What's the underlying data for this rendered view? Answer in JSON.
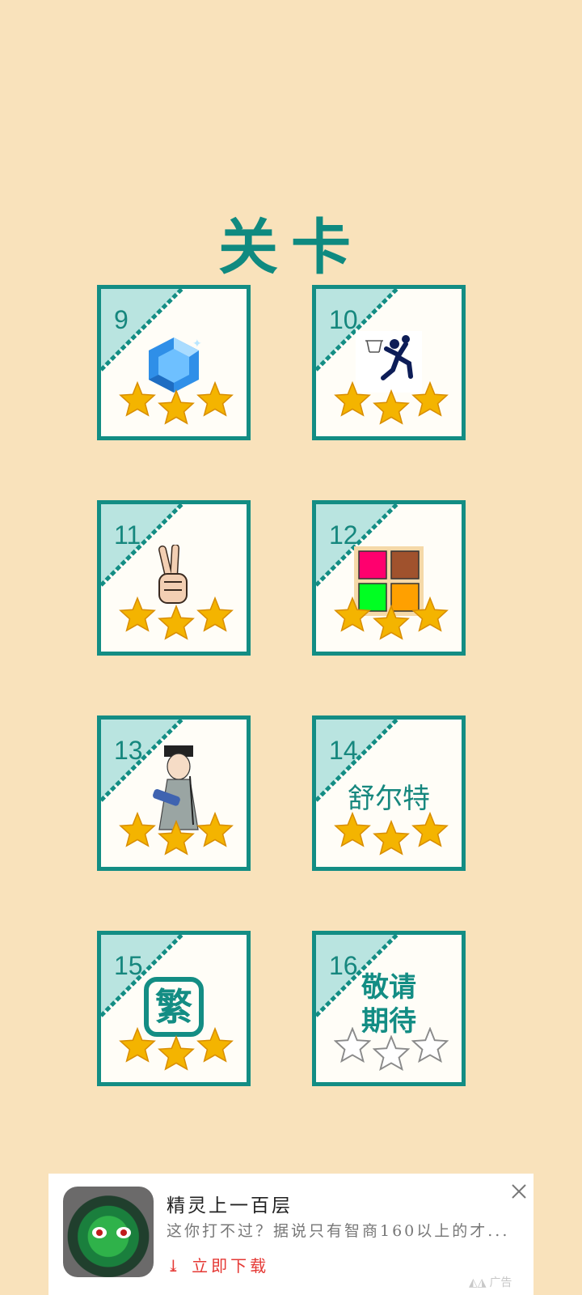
{
  "title": "关卡",
  "levels": [
    {
      "number": "9",
      "icon": "blue-gem-icon",
      "stars": 3
    },
    {
      "number": "10",
      "icon": "basketball-pictogram-icon",
      "stars": 3
    },
    {
      "number": "11",
      "icon": "victory-hand-icon",
      "stars": 3
    },
    {
      "number": "12",
      "icon": "color-grid-icon",
      "stars": 3
    },
    {
      "number": "13",
      "icon": "scholar-character-icon",
      "stars": 3
    },
    {
      "number": "14",
      "icon_text": "舒尔特",
      "stars": 3
    },
    {
      "number": "15",
      "icon_text": "繁",
      "stars": 3
    },
    {
      "number": "16",
      "icon_text_line1": "敬请",
      "icon_text_line2": "期待",
      "stars": 0
    }
  ],
  "ad": {
    "app_name": "精灵上一百层",
    "description": "这你打不过？据说只有智商160以上的才...",
    "cta": "立即下载",
    "label": "广告"
  },
  "colors": {
    "background": "#f9e2bb",
    "accent": "#138d84",
    "star": "#f4b400",
    "cta": "#e53935"
  }
}
